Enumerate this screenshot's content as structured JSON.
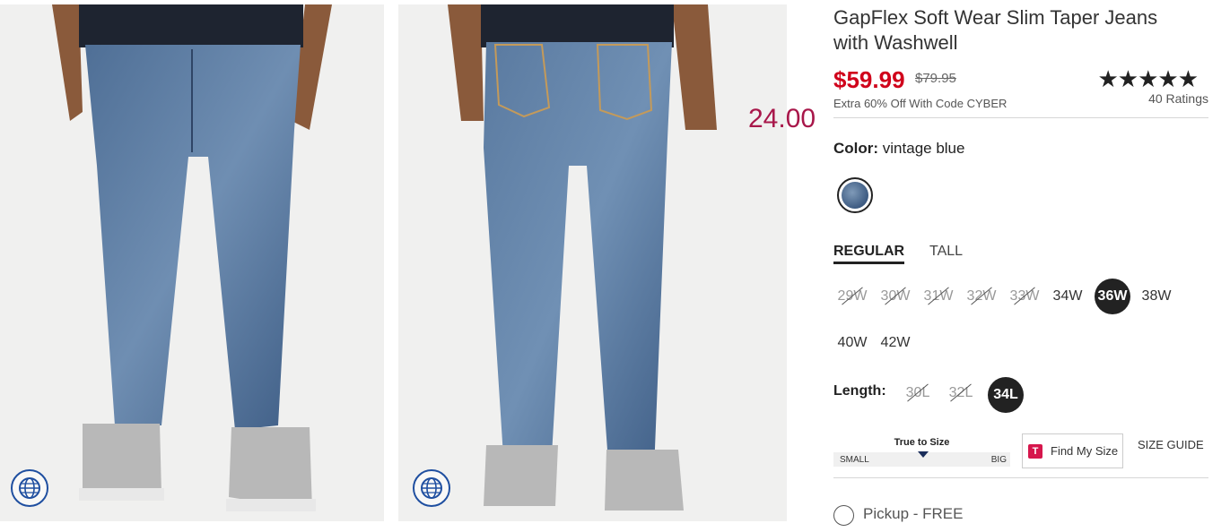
{
  "product": {
    "title": "GapFlex Soft Wear Slim Taper Jeans with Washwell",
    "sale_price": "$59.99",
    "original_price": "$79.95",
    "promo": "Extra 60% Off With Code CYBER",
    "rating_stars": "★★★★★",
    "rating_value": 5,
    "ratings_count": "40 Ratings"
  },
  "overlay_price": "24.00",
  "color": {
    "label": "Color:",
    "value": "vintage blue",
    "swatch_color": "#4a6a91"
  },
  "fit_tabs": [
    {
      "label": "REGULAR",
      "active": true
    },
    {
      "label": "TALL",
      "active": false
    }
  ],
  "waist_sizes": [
    {
      "label": "29W",
      "available": false,
      "selected": false
    },
    {
      "label": "30W",
      "available": false,
      "selected": false
    },
    {
      "label": "31W",
      "available": false,
      "selected": false
    },
    {
      "label": "32W",
      "available": false,
      "selected": false
    },
    {
      "label": "33W",
      "available": false,
      "selected": false
    },
    {
      "label": "34W",
      "available": true,
      "selected": false
    },
    {
      "label": "36W",
      "available": true,
      "selected": true
    },
    {
      "label": "38W",
      "available": true,
      "selected": false
    },
    {
      "label": "40W",
      "available": true,
      "selected": false
    },
    {
      "label": "42W",
      "available": true,
      "selected": false
    }
  ],
  "length": {
    "label": "Length:",
    "sizes": [
      {
        "label": "30L",
        "available": false,
        "selected": false
      },
      {
        "label": "32L",
        "available": false,
        "selected": false
      },
      {
        "label": "34L",
        "available": true,
        "selected": true
      }
    ]
  },
  "fit_meter": {
    "title": "True to Size",
    "small": "SMALL",
    "big": "BIG"
  },
  "find_my_size": {
    "icon_letter": "T",
    "label": "Find My Size"
  },
  "size_guide": "SIZE GUIDE",
  "pickup": "Pickup - FREE",
  "colors": {
    "sale_red": "#d0021b",
    "overlay_magenta": "#a8174a",
    "denim": "#4a6a91",
    "badge_blue": "#1f4fa0"
  }
}
